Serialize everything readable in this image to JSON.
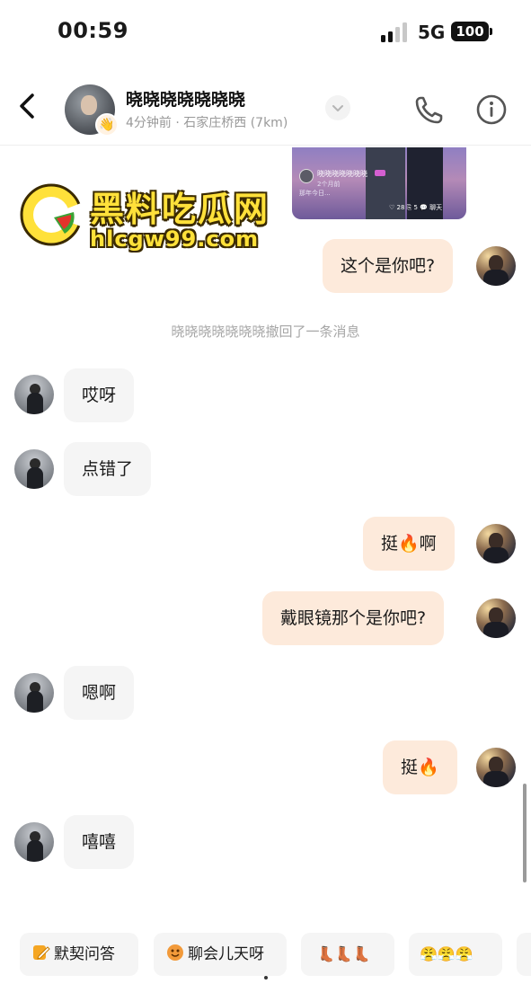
{
  "status_bar": {
    "time": "00:59",
    "network": "5G",
    "battery": "100"
  },
  "header": {
    "contact_name": "晓晓晓晓晓晓晓",
    "subtitle": "4分钟前 · 石家庄桥西 (7km)",
    "avatar_badge_icon": "hand-wave-icon"
  },
  "watermark": {
    "title": "黑料吃瓜网",
    "url": "hlcgw99.com"
  },
  "shared_post": {
    "author": "晓晓晓晓晓晓晓",
    "meta": "2个月前",
    "caption": "那年今日...",
    "stats": "♡ 28   ⎘ 5   💬 聊天"
  },
  "messages": [
    {
      "from": "me",
      "text": "这个是你吧?"
    },
    {
      "from": "system",
      "text": "晓晓晓晓晓晓晓撤回了一条消息"
    },
    {
      "from": "them",
      "text": "哎呀"
    },
    {
      "from": "them",
      "text": "点错了"
    },
    {
      "from": "me",
      "text": "挺🔥啊"
    },
    {
      "from": "me",
      "text": "戴眼镜那个是你吧?"
    },
    {
      "from": "them",
      "text": "嗯啊"
    },
    {
      "from": "me",
      "text": "挺🔥"
    },
    {
      "from": "them",
      "text": "嘻嘻"
    }
  ],
  "quick_replies": [
    {
      "label": "默契问答",
      "icon": "pencil-note-icon"
    },
    {
      "label": "聊会儿天呀",
      "icon": "chat-face-icon"
    },
    {
      "label": "👢👢👢",
      "icon": ""
    },
    {
      "label": "😤😤😤",
      "icon": ""
    },
    {
      "label": "",
      "icon": "more-chip-icon"
    }
  ],
  "colors": {
    "my_bubble": "#fdeadb",
    "their_bubble": "#f5f5f5",
    "watermark_text": "#ffe13a"
  }
}
